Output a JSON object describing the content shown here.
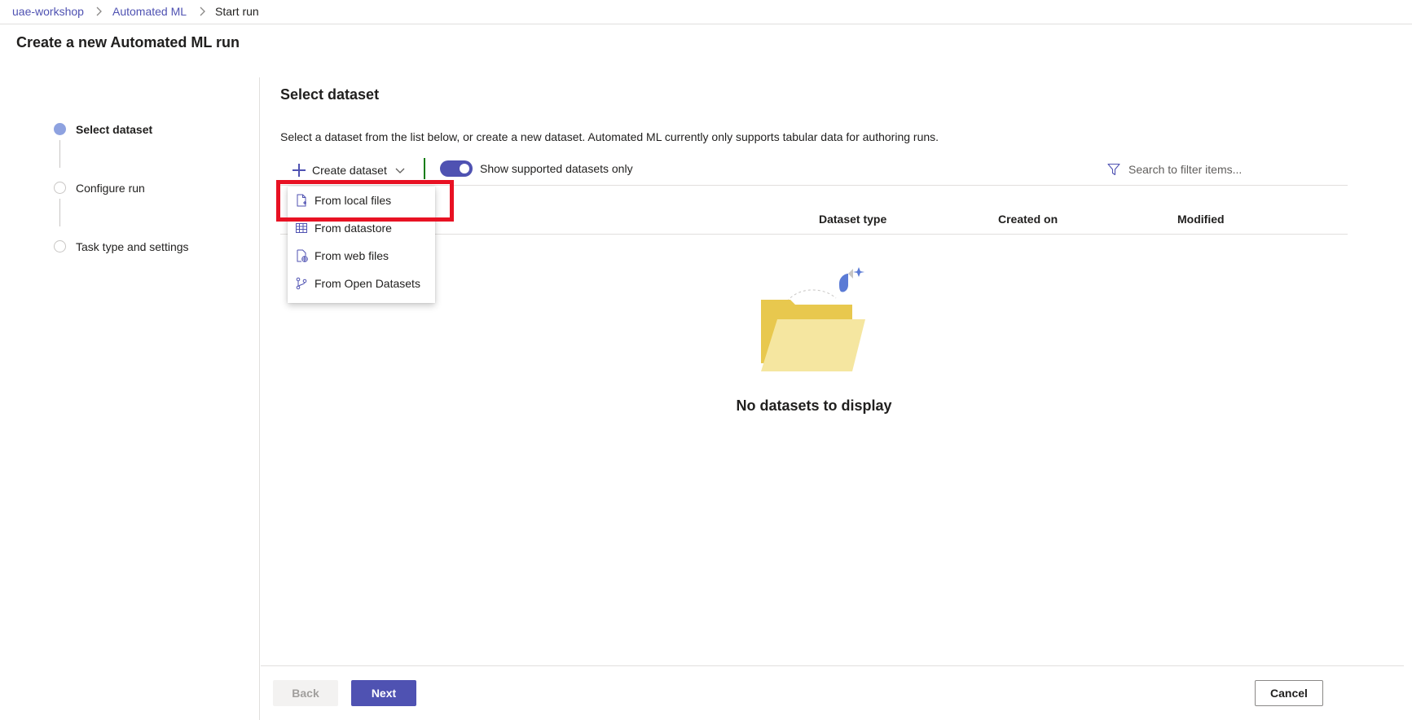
{
  "breadcrumb": {
    "items": [
      {
        "label": "uae-workshop"
      },
      {
        "label": "Automated ML"
      },
      {
        "label": "Start run"
      }
    ]
  },
  "page": {
    "title": "Create a new Automated ML run"
  },
  "stepper": {
    "steps": [
      {
        "label": "Select dataset",
        "active": true
      },
      {
        "label": "Configure run",
        "active": false
      },
      {
        "label": "Task type and settings",
        "active": false
      }
    ]
  },
  "main": {
    "section_title": "Select dataset",
    "description": "Select a dataset from the list below, or create a new dataset. Automated ML currently only supports tabular data for authoring runs."
  },
  "toolbar": {
    "create_label": "Create dataset",
    "toggle_label": "Show supported datasets only",
    "toggle_on": true,
    "search_placeholder": "Search to filter items..."
  },
  "dropdown": {
    "items": [
      {
        "label": "From local files",
        "icon": "file-add-icon"
      },
      {
        "label": "From datastore",
        "icon": "table-icon"
      },
      {
        "label": "From web files",
        "icon": "web-file-icon"
      },
      {
        "label": "From Open Datasets",
        "icon": "branch-icon"
      }
    ]
  },
  "table": {
    "columns": [
      "Dataset type",
      "Created on",
      "Modified"
    ]
  },
  "empty_state": {
    "message": "No datasets to display"
  },
  "footer": {
    "back_label": "Back",
    "next_label": "Next",
    "cancel_label": "Cancel"
  },
  "colors": {
    "accent": "#4f52b2",
    "highlight": "#e81123",
    "folder": "#ecc94b"
  }
}
